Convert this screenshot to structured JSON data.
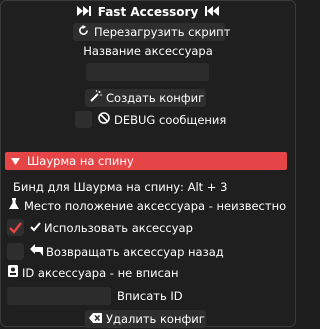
{
  "window": {
    "title": "Fast Accessory",
    "title_icon_left": "fast-forward-icon",
    "title_icon_right": "fast-backward-icon"
  },
  "actions": {
    "reload_label": "Перезагрузить скрипт",
    "accessory_name_label": "Название аксессуара",
    "accessory_name_value": "",
    "create_config_label": "Создать конфиг",
    "debug_label": "DEBUG сообщения"
  },
  "section": {
    "title": "Шаурма на спину",
    "bind_text": "Бинд для Шаурма на спину: Alt + 3",
    "location_text": "Место положение аксессуара - неизвестно",
    "use_label": "Использовать аксессуар",
    "use_checked": true,
    "return_label": "Возвращать аксессуар назад",
    "return_checked": false,
    "id_text": "ID аксессуара - не вписан",
    "id_input_value": "",
    "enter_id_label": "Вписать ID",
    "delete_config_label": "Удалить конфиг"
  },
  "colors": {
    "accent": "#e64547",
    "background": "#1f1f1f",
    "control": "#2e2e2e"
  }
}
